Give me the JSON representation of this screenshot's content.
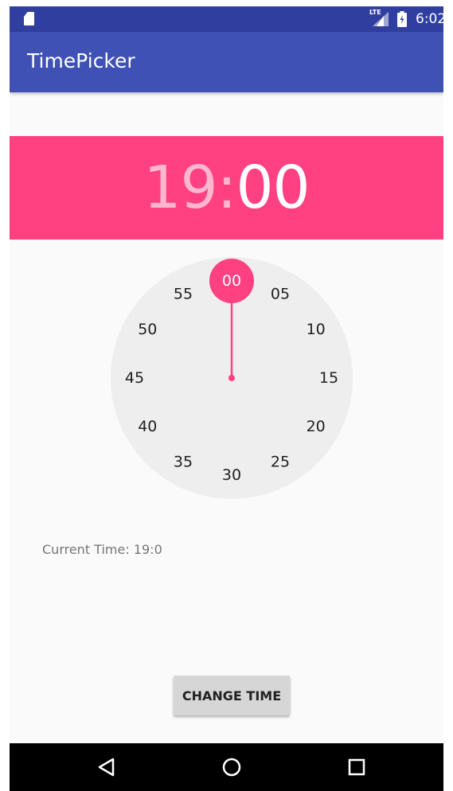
{
  "status_bar": {
    "network_label": "LTE",
    "clock": "6:02",
    "icons": [
      "sd-card-icon",
      "signal-icon",
      "battery-icon"
    ]
  },
  "app_bar": {
    "title": "TimePicker"
  },
  "picker": {
    "hours": "19",
    "separator": ":",
    "minutes": "00",
    "selected_label": "00",
    "dial_labels": [
      "00",
      "05",
      "10",
      "15",
      "20",
      "25",
      "30",
      "35",
      "40",
      "45",
      "50",
      "55"
    ],
    "accent_color": "#ff4081",
    "dial_color": "#eeeeee"
  },
  "current_time_text": "Current Time: 19:0",
  "change_button_label": "CHANGE TIME",
  "nav_bar": {
    "icons": [
      "back-icon",
      "home-icon",
      "recents-icon"
    ]
  },
  "colors": {
    "status_bar": "#303f9f",
    "app_bar": "#3f51b5",
    "accent": "#ff4081",
    "background": "#fafafa"
  }
}
